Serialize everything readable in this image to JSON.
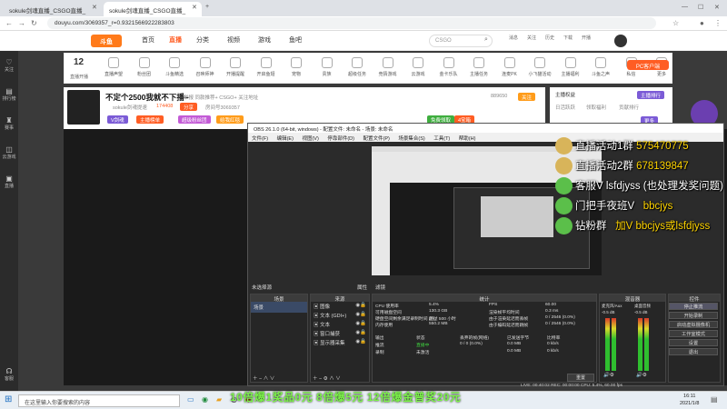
{
  "browser": {
    "tabs": [
      {
        "title": "sokule剑魂直播_CSGO直播_"
      },
      {
        "title": "sokule剑魂直播_CSGO直播_"
      }
    ],
    "url": "douyu.com/3069357_r=0.9321566922283803"
  },
  "site": {
    "nav": [
      "首页",
      "直播",
      "分类",
      "视频",
      "游戏",
      "鱼吧"
    ],
    "search_placeholder": "CSGO",
    "header_icons": [
      "消息",
      "关注",
      "历史",
      "下载",
      "开播"
    ]
  },
  "sidebar": [
    "关注",
    "排行榜",
    "赛事",
    "云游戏",
    "直播",
    "客服"
  ],
  "gifts": {
    "level": "12",
    "level_label": "直播开播",
    "items": [
      "直播声望",
      "粉丝团",
      "斗鱼精选",
      "召唤师神",
      "开播提醒",
      "开启鱼翅",
      "宠物",
      "贵族",
      "超级任务",
      "竞猜游戏",
      "云游戏",
      "金卡乐队",
      "主播任务",
      "连麦PK",
      "小飞猫活动",
      "主播福利",
      "斗鱼之声",
      "私信",
      "更多"
    ],
    "pc_client": "PC客户端"
  },
  "room": {
    "title": "不定个2500我就不下播~",
    "tags": "举报  同款推荐+  CSGO+  关注地址",
    "streamer": "sokule剑魂提速",
    "followers": "174408",
    "badge_red": "分享",
    "badge_room": "房间号3069357",
    "v_tag": "V剑魂",
    "tag1": "主播榜单",
    "tag2": "超级粉丝团",
    "tag3": "给我红毯",
    "fans": "889650",
    "fans_btn": "关注",
    "gift_btn": "免费领取",
    "gift_btn2": "4宝箱"
  },
  "rightpanel": {
    "title": "主播权益",
    "item1": "日活跃跃",
    "item2": "领取福利",
    "item3": "贡献排行",
    "rank_btn": "主播排行",
    "side_label": "更多"
  },
  "obs": {
    "title": "OBS 26.1.0 (64-bit, windows) - 配置文件: 未命名 - 场景: 未命名",
    "menu": [
      "文件(F)",
      "编辑(E)",
      "视图(V)",
      "停靠部件(D)",
      "配置文件(P)",
      "场景集合(S)",
      "工具(T)",
      "帮助(H)"
    ],
    "no_source": "未选择源",
    "prop_btn": "属性",
    "filter_btn": "滤镜",
    "scenes_hdr": "场景",
    "scene_item": "场景",
    "sources_hdr": "来源",
    "sources": [
      "图像",
      "文本 (GDI+)",
      "文本",
      "窗口捕获",
      "显示器采集"
    ],
    "stats_hdr": "统计",
    "stats": [
      {
        "k": "CPU 使用率",
        "v": "5.4%",
        "k2": "FPS",
        "v2": "60.00"
      },
      {
        "k": "可用磁盘空间",
        "v": "130.3 GB",
        "k2": "渲染帧平均时间",
        "v2": "0.3 ms"
      },
      {
        "k": "硬盘空间剩余满足录制时间 (约)",
        "v": "超过 500 小时",
        "k2": "由于渲染延迟而丢帧",
        "v2": "0 / 2546 (0.0%)"
      },
      {
        "k": "内存使用",
        "v": "550.2 MB",
        "k2": "由于编码延迟而跳帧",
        "v2": "0 / 2546 (0.0%)"
      }
    ],
    "out_headers": [
      "输出",
      "状态",
      "丢弃的帧(网络)",
      "已发送字节",
      "比特率"
    ],
    "outputs": [
      {
        "name": "推流",
        "status": "直播中",
        "dropped": "0 / 0 (0.0%)",
        "sent": "0.0 MB",
        "rate": "0 kb/s"
      },
      {
        "name": "录制",
        "status": "未激活",
        "dropped": "",
        "sent": "0.0 MB",
        "rate": "0 kb/s"
      }
    ],
    "reset_btn": "重置",
    "mixer_hdr": "混音器",
    "mixer_tracks": [
      {
        "name": "麦克风/Aux",
        "db": "-0.5 dB"
      },
      {
        "name": "桌面音频",
        "db": "-0.5 dB"
      }
    ],
    "controls_hdr": "控件",
    "controls": [
      "停止推流",
      "开始录制",
      "启动虚拟摄像机",
      "工作室模式",
      "设置",
      "退出"
    ],
    "status_bar": "LIVE: 00:40:02   REC: 00:00:00   CPU: 5.4%, 60.00 fps"
  },
  "overlay": [
    {
      "label": "直播活动1群",
      "value": "575470775"
    },
    {
      "label": "直播活动2群",
      "value": "678139847"
    },
    {
      "label": "客服V  lsfdjyss  (也处理发奖问题)",
      "value": ""
    },
    {
      "label": "门把手夜班V",
      "value": "bbcjys"
    },
    {
      "label": "钻粉群",
      "value": "加V bbcjys或lsfdjyss"
    }
  ],
  "marquee": "10倍爆1奖品0元 8倍爆5元 12倍爆金普奖20元",
  "taskbar": {
    "search": "在这里输入你要搜索的内容",
    "time": "16:11",
    "date": "2021/1/8"
  }
}
